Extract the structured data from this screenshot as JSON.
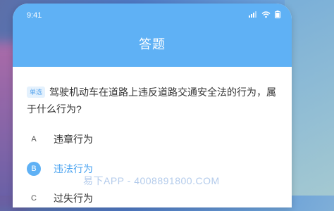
{
  "status_bar": {
    "time": "9:41"
  },
  "header": {
    "title": "答题"
  },
  "question": {
    "type_badge": "单选",
    "text": "驾驶机动车在道路上违反道路交通安全法的行为，属于什么行为?"
  },
  "options": [
    {
      "letter": "A",
      "text": "违章行为",
      "selected": false
    },
    {
      "letter": "B",
      "text": "违法行为",
      "selected": true
    },
    {
      "letter": "C",
      "text": "过失行为",
      "selected": false
    }
  ],
  "watermark": "易下APP - 4008891800.COM",
  "colors": {
    "accent": "#5fb1f5",
    "selected_text": "#4aa3f0"
  },
  "icons": [
    "signal-icon",
    "wifi-icon",
    "battery-icon"
  ]
}
